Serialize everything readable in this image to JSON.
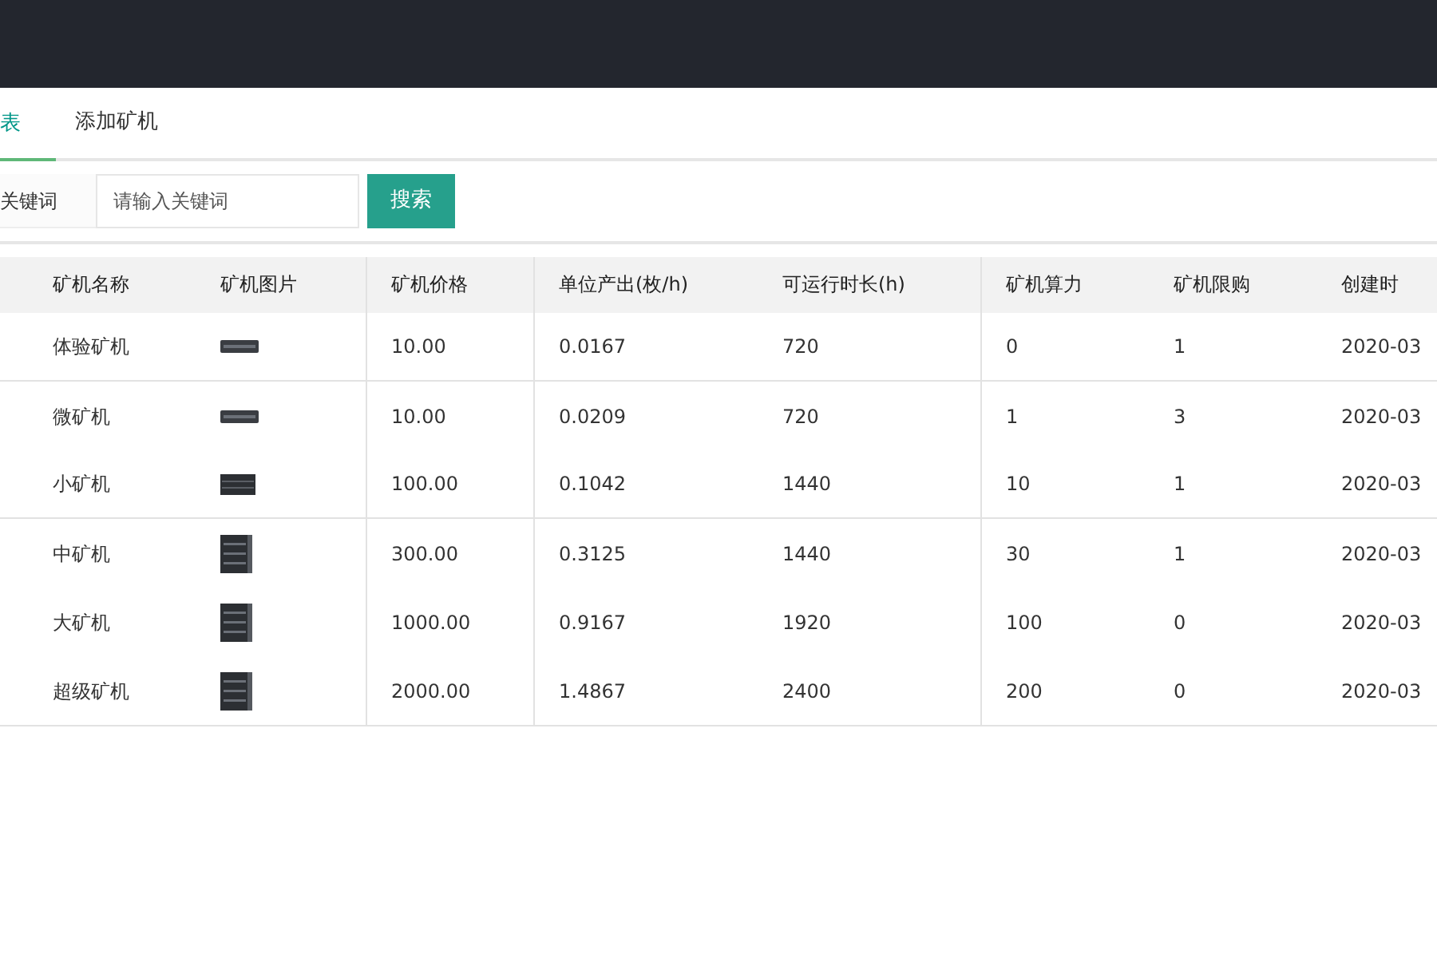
{
  "tabs": [
    {
      "label": "表",
      "selected": true
    },
    {
      "label": "添加矿机",
      "selected": false
    }
  ],
  "search": {
    "label": "关键词",
    "placeholder": "请输入关键词",
    "button": "搜索"
  },
  "table": {
    "columns": [
      "矿机名称",
      "矿机图片",
      "矿机价格",
      "单位产出(枚/h)",
      "可运行时长(h)",
      "矿机算力",
      "矿机限购",
      "创建时"
    ],
    "rows": [
      {
        "name": "体验矿机",
        "kind": "slim",
        "price": "10.00",
        "output": "0.0167",
        "runtime": "720",
        "power": "0",
        "limit": "1",
        "created": "2020-03"
      },
      {
        "name": "微矿机",
        "kind": "slim",
        "price": "10.00",
        "output": "0.0209",
        "runtime": "720",
        "power": "1",
        "limit": "3",
        "created": "2020-03"
      },
      {
        "name": "小矿机",
        "kind": "block",
        "price": "100.00",
        "output": "0.1042",
        "runtime": "1440",
        "power": "10",
        "limit": "1",
        "created": "2020-03"
      },
      {
        "name": "中矿机",
        "kind": "tower",
        "price": "300.00",
        "output": "0.3125",
        "runtime": "1440",
        "power": "30",
        "limit": "1",
        "created": "2020-03"
      },
      {
        "name": "大矿机",
        "kind": "tower",
        "price": "1000.00",
        "output": "0.9167",
        "runtime": "1920",
        "power": "100",
        "limit": "0",
        "created": "2020-03"
      },
      {
        "name": "超级矿机",
        "kind": "tower",
        "price": "2000.00",
        "output": "1.4867",
        "runtime": "2400",
        "power": "200",
        "limit": "0",
        "created": "2020-03"
      }
    ]
  }
}
